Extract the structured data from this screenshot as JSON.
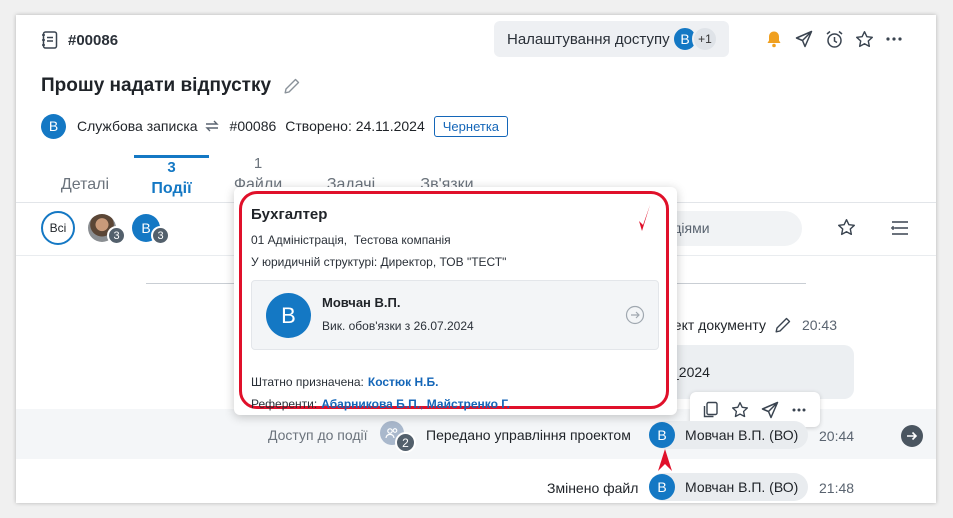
{
  "header": {
    "doc_number": "#00086",
    "access_button": "Налаштування доступу",
    "access_avatar": "В",
    "access_more": "+1"
  },
  "title": "Прошу надати відпустку",
  "meta": {
    "avatar": "В",
    "doc_type": "Службова записка",
    "number": "#00086",
    "created": "Створено: 24.11.2024",
    "status": "Чернетка"
  },
  "tabs": [
    {
      "label": "Деталі",
      "count": ""
    },
    {
      "label": "Події",
      "count": "3"
    },
    {
      "label": "Файли",
      "count": "1"
    },
    {
      "label": "Задачі",
      "count": ""
    },
    {
      "label": "Зв'язки",
      "count": ""
    }
  ],
  "filters": {
    "all": "Всі",
    "person1_count": "3",
    "person2_avatar": "В",
    "person2_count": "3",
    "search_placeholder": "Пошук за подіями"
  },
  "events": [
    {
      "text": "оект документу",
      "time": "20:43"
    },
    {
      "bubble": "_2024"
    },
    {
      "prefix": "Доступ до події",
      "group_count": "2",
      "text": "Передано управління проектом",
      "avatar": "В",
      "user": "Мовчан В.П. (ВО)",
      "time": "20:44"
    },
    {
      "text": "Змінено файл",
      "avatar": "В",
      "user": "Мовчан В.П. (ВО)",
      "time": "21:48"
    }
  ],
  "popup": {
    "role": "Бухгалтер",
    "org": "01 Адміністрація,  Тестова компанія",
    "structure": "У юридичній структурі: Директор, ТОВ \"ТЕСТ\"",
    "person": {
      "avatar": "В",
      "name": "Мовчан В.П.",
      "acting": "Вик. обов'язки з 26.07.2024"
    },
    "assigned_label": "Штатно призначена:",
    "assigned_name": "Костюк Н.Б.",
    "referents_label": "Референти:",
    "referent1": "Абарникова Б.П.",
    "referent2": "Майстренко Г."
  },
  "colors": {
    "accent": "#1478c4",
    "highlight_red": "#e0102a",
    "bell": "#f0a020"
  }
}
